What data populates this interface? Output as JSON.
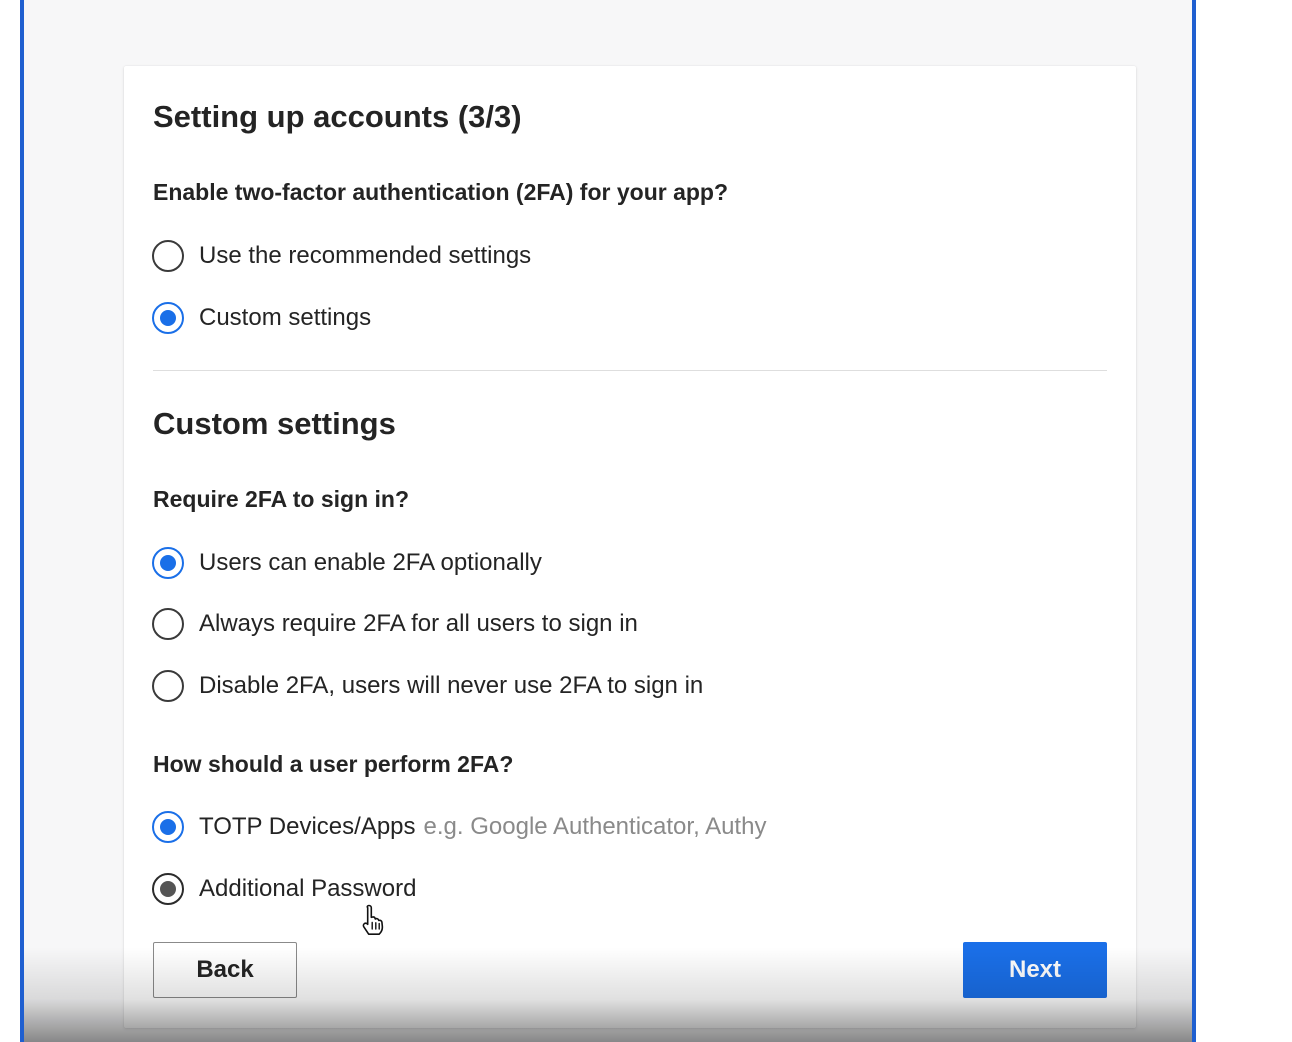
{
  "wizard": {
    "title": "Setting up accounts (3/3)",
    "enable_question": "Enable two-factor authentication (2FA) for your app?",
    "enable_options": [
      {
        "label": "Use the recommended settings",
        "selected": false
      },
      {
        "label": "Custom settings",
        "selected": true
      }
    ],
    "custom_section_title": "Custom settings",
    "require_question": "Require 2FA to sign in?",
    "require_options": [
      {
        "label": "Users can enable 2FA optionally",
        "selected": true
      },
      {
        "label": "Always require 2FA for all users to sign in",
        "selected": false
      },
      {
        "label": "Disable 2FA, users will never use 2FA to sign in",
        "selected": false
      }
    ],
    "method_question": "How should a user perform 2FA?",
    "method_options": [
      {
        "label": "TOTP Devices/Apps",
        "hint": "e.g. Google Authenticator, Authy",
        "selected": true
      },
      {
        "label": "Additional Password",
        "selected": true
      }
    ],
    "back_label": "Back",
    "next_label": "Next"
  },
  "colors": {
    "accent": "#1a6fe8",
    "frame_border": "#1f5fd0"
  },
  "icons": {
    "cursor": "hand-pointer-icon"
  }
}
